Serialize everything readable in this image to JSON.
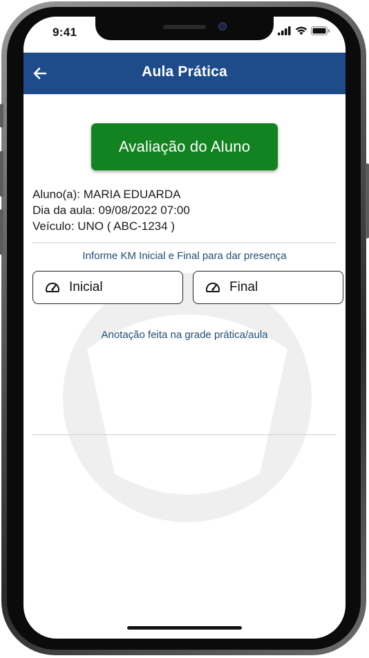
{
  "status_bar": {
    "time": "9:41",
    "icons": [
      "cellular-signal-icon",
      "wifi-icon",
      "battery-icon"
    ]
  },
  "header": {
    "title": "Aula Prática",
    "back_icon": "arrow-left-icon",
    "color": "#1e4b8a"
  },
  "evaluation_button": {
    "label": "Avaliação do Aluno",
    "color": "#138220"
  },
  "lesson_info": {
    "student": "Aluno(a): MARIA EDUARDA",
    "date": "Dia da aula: 09/08/2022 07:00",
    "vehicle": "Veículo: UNO ( ABC-1234 )"
  },
  "km": {
    "hint": "Informe KM Inicial e Final para dar presença",
    "initial_label": "Inicial",
    "final_label": "Final",
    "icon": "speedometer-icon"
  },
  "annotation": {
    "text": "Anotação feita na grade prática/aula"
  },
  "colors": {
    "link_text": "#1e4c74"
  }
}
